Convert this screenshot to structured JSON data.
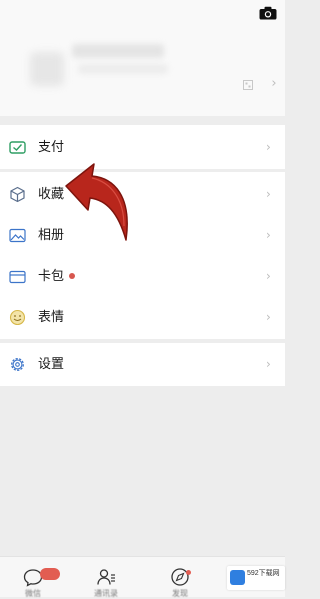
{
  "menu": {
    "pay": "支付",
    "favorites": "收藏",
    "album": "相册",
    "cards": "卡包",
    "stickers": "表情",
    "settings": "设置"
  },
  "tabbar": {
    "chats": "微信",
    "contacts": "通讯录",
    "discover": "发现"
  },
  "watermark": {
    "text_line1": "592下载网",
    "text_line2": ""
  },
  "colors": {
    "accent_green": "#2f9e63",
    "badge_red": "#e25d52",
    "arrow_red": "#b8261c"
  }
}
